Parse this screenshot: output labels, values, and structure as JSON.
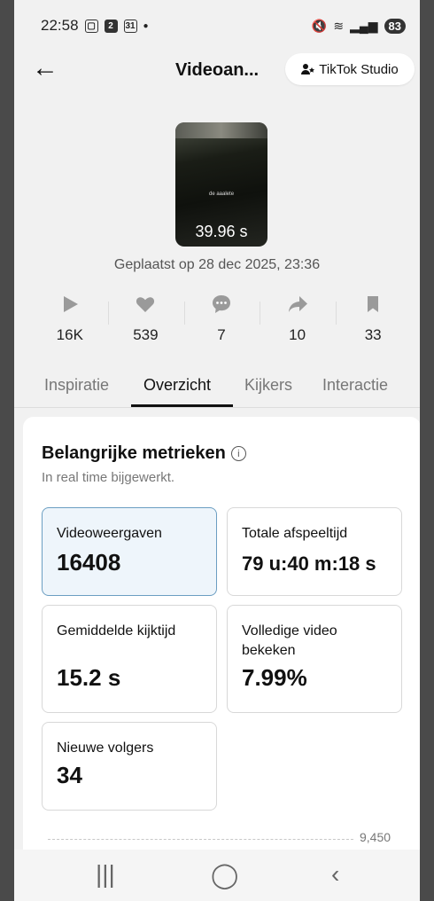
{
  "status_bar": {
    "time": "22:58",
    "icons": [
      "screen-record-icon",
      "notification-2-icon",
      "calendar-31-icon"
    ],
    "right_icons": [
      "mute-icon",
      "wifi-icon",
      "signal-icon"
    ],
    "battery": "83"
  },
  "header": {
    "title": "Videoan...",
    "studio_button": "TikTok Studio"
  },
  "video": {
    "duration": "39.96 s",
    "caption": "de aaalete",
    "posted": "Geplaatst op 28 dec 2025, 23:36"
  },
  "stats": [
    {
      "icon": "play-icon",
      "value": "16K"
    },
    {
      "icon": "heart-icon",
      "value": "539"
    },
    {
      "icon": "comment-icon",
      "value": "7"
    },
    {
      "icon": "share-icon",
      "value": "10"
    },
    {
      "icon": "bookmark-icon",
      "value": "33"
    }
  ],
  "tabs": [
    "Inspiratie",
    "Overzicht",
    "Kijkers",
    "Interactie"
  ],
  "active_tab": "Overzicht",
  "metrics": {
    "title": "Belangrijke metrieken",
    "subtitle": "In real time bijgewerkt.",
    "items": [
      {
        "label": "Videoweergaven",
        "value": "16408"
      },
      {
        "label": "Totale afspeeltijd",
        "value": "79 u:40 m:18 s"
      },
      {
        "label": "Gemiddelde kijktijd",
        "value": "15.2 s"
      },
      {
        "label": "Volledige video bekeken",
        "value": "7.99%"
      },
      {
        "label": "Nieuwe volgers",
        "value": "34"
      }
    ]
  },
  "chart": {
    "axis_value": "9,450"
  },
  "colors": {
    "accent": "#111111",
    "selected_bg": "#eef5fb",
    "selected_border": "#6b9ec2"
  }
}
